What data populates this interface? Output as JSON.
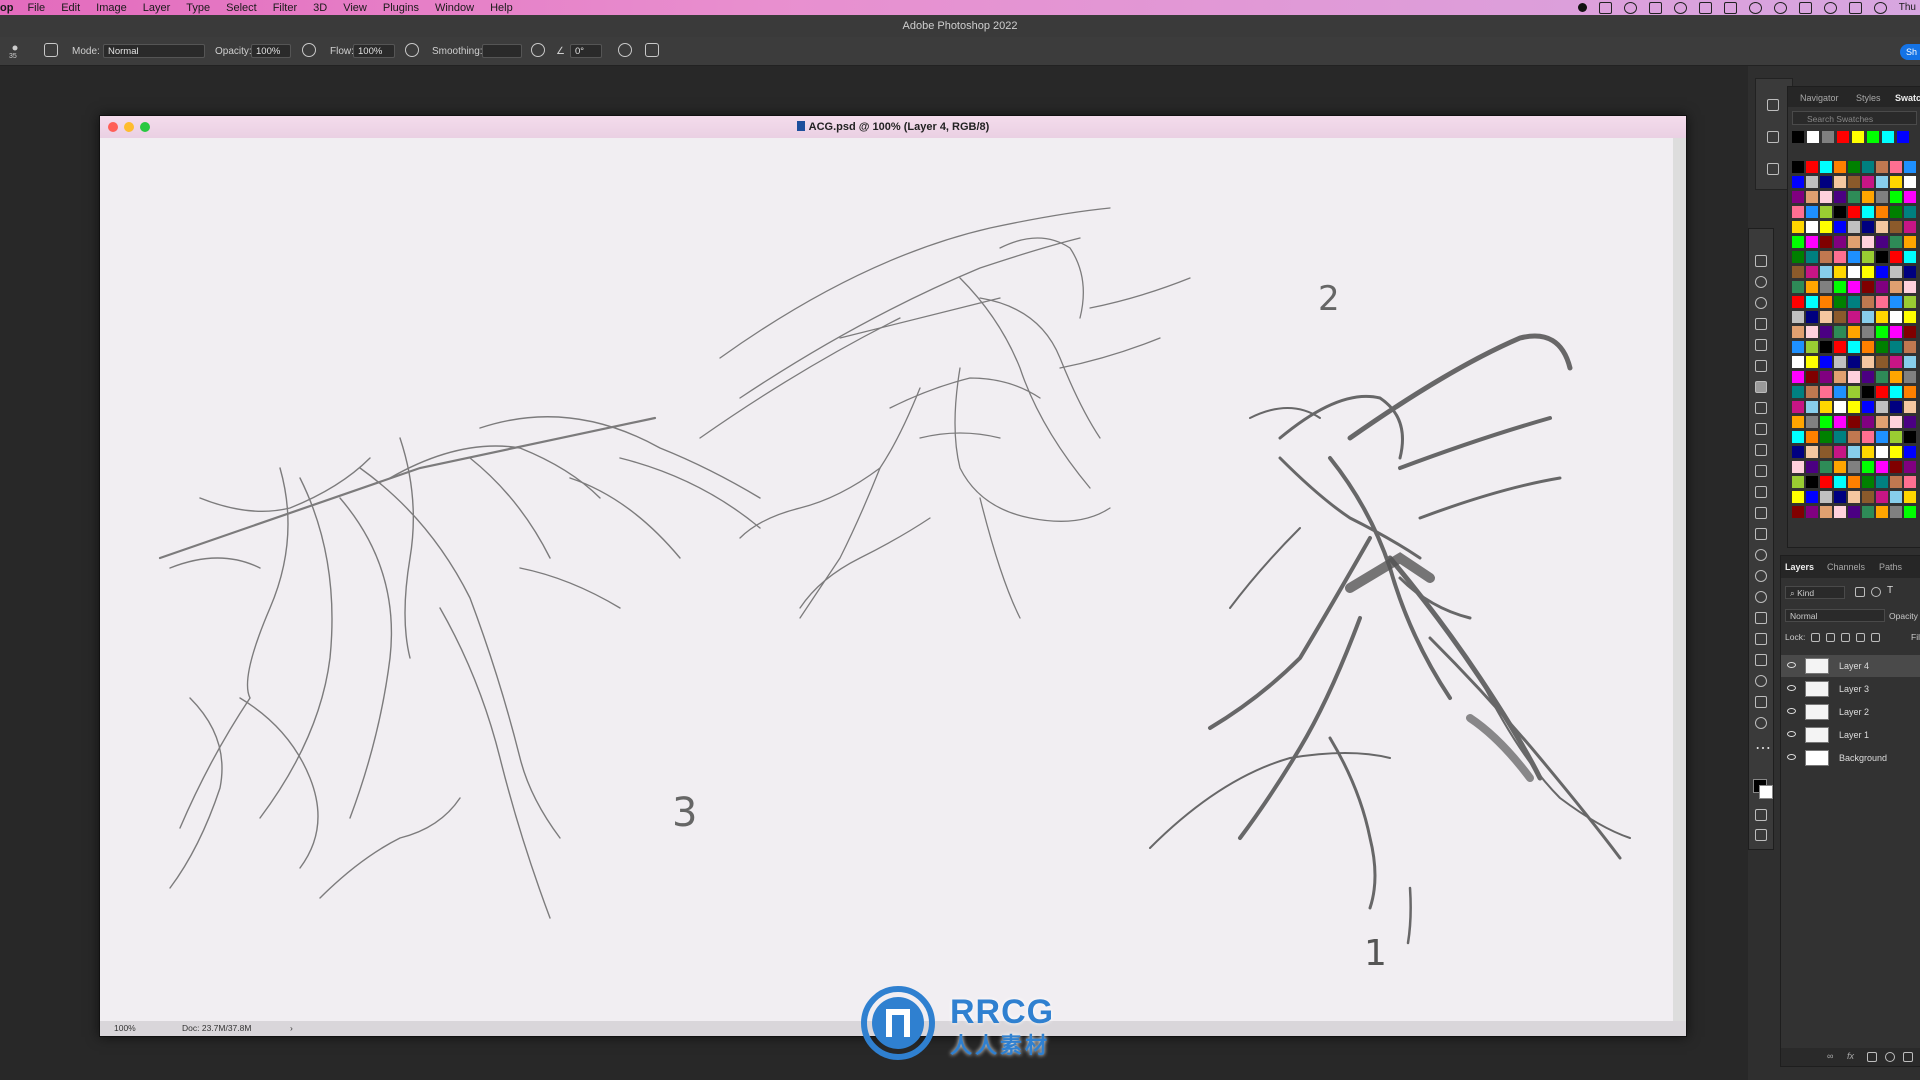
{
  "menubar": {
    "app_name": "op",
    "items": [
      "File",
      "Edit",
      "Image",
      "Layer",
      "Type",
      "Select",
      "Filter",
      "3D",
      "View",
      "Plugins",
      "Window",
      "Help"
    ],
    "clock": "Thu"
  },
  "app_title": "Adobe Photoshop 2022",
  "options_bar": {
    "brush_size": "35",
    "mode_label": "Mode:",
    "mode_value": "Normal",
    "opacity_label": "Opacity:",
    "opacity_value": "100%",
    "flow_label": "Flow:",
    "flow_value": "100%",
    "smoothing_label": "Smoothing:",
    "smoothing_value": "",
    "angle_value": "0°",
    "share_label": "Sh"
  },
  "document": {
    "title": "ACG.psd @ 100% (Layer 4, RGB/8)",
    "zoom": "100%",
    "doc_size": "Doc: 23.7M/37.8M",
    "sketch_labels": [
      "2",
      "3",
      "1"
    ]
  },
  "watermark": {
    "logo_text": "RRCG",
    "logo_subtext": "人人素材"
  },
  "swatches_panel": {
    "tabs": [
      "Navigator",
      "Styles",
      "Swatc"
    ],
    "active_tab": "Swatc",
    "search_placeholder": "Search Swatches",
    "palette": [
      "#000000",
      "#ffffff",
      "#808080",
      "#ff0000",
      "#ffff00",
      "#00ff00",
      "#00ffff",
      "#0000ff",
      "#ff00ff",
      "#ff8000",
      "#c0c0c0",
      "#800000",
      "#008000",
      "#000080",
      "#800080",
      "#008080",
      "#f4c7a0",
      "#e0a070",
      "#c07850",
      "#8b5a2b",
      "#ffd1dc",
      "#ff6f91",
      "#c71585",
      "#4b0082",
      "#1e90ff",
      "#87ceeb",
      "#2e8b57",
      "#9acd32",
      "#ffd700",
      "#ffa500"
    ]
  },
  "layers_panel": {
    "tabs": [
      "Layers",
      "Channels",
      "Paths"
    ],
    "active_tab": "Layers",
    "filter_label": "Kind",
    "blend_mode": "Normal",
    "opacity_label": "Opacity",
    "lock_label": "Lock:",
    "fill_label": "Fill",
    "layers": [
      {
        "name": "Layer 4",
        "selected": true
      },
      {
        "name": "Layer 3",
        "selected": false
      },
      {
        "name": "Layer 2",
        "selected": false
      },
      {
        "name": "Layer 1",
        "selected": false
      },
      {
        "name": "Background",
        "selected": false
      }
    ]
  }
}
